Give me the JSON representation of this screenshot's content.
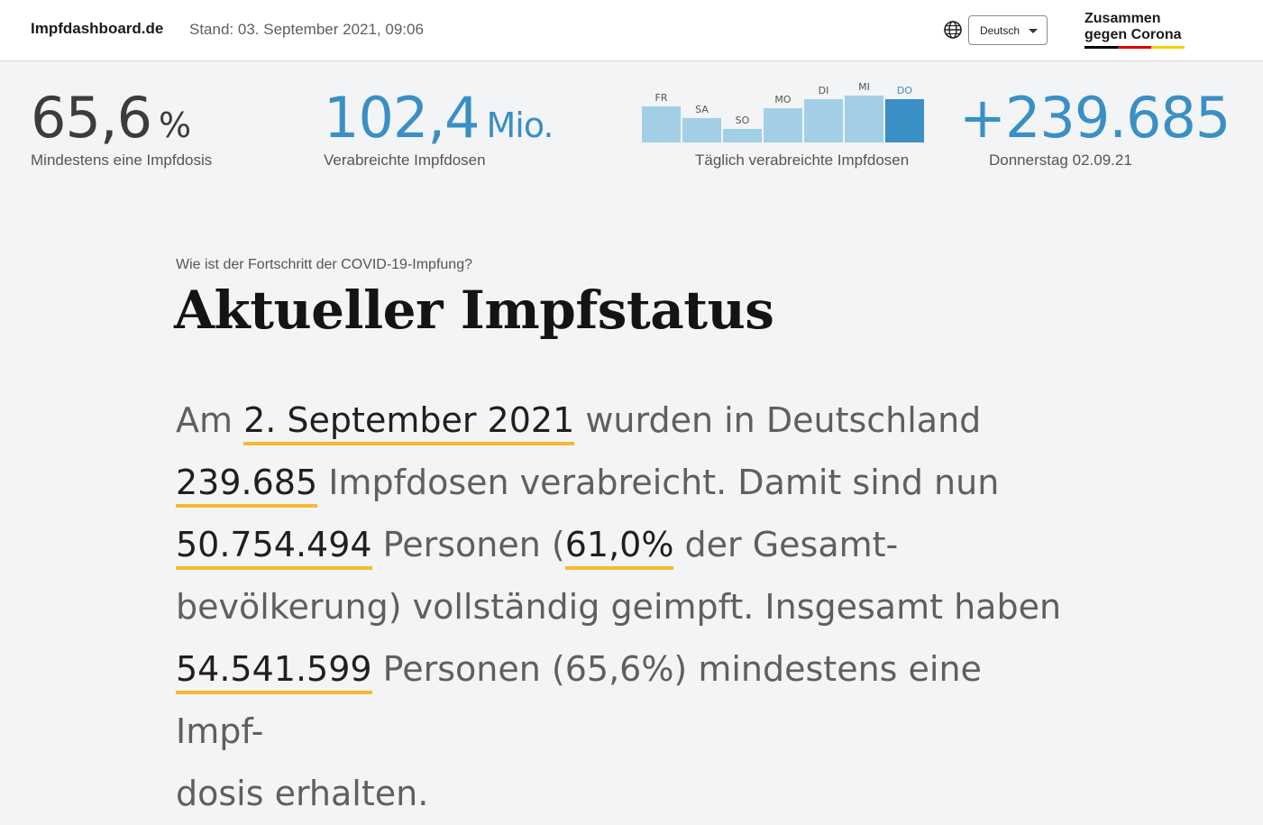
{
  "header": {
    "brand": "Impfdashboard.de",
    "stand": "Stand: 03. September 2021, 09:06",
    "globe_icon": "globe-icon",
    "language": "Deutsch",
    "logo_line1": "Zusammen",
    "logo_line2": "gegen Corona",
    "logo_colors": [
      "#000000",
      "#dd0000",
      "#ffcc00"
    ]
  },
  "stats": {
    "first_dose_value": "65,6",
    "first_dose_unit": "%",
    "first_dose_label": "Mindestens eine Impfdosis",
    "total_value": "102,4",
    "total_unit": "Mio.",
    "total_label": "Verabreichte Impfdosen",
    "daily_chart_label": "Täglich verabreichte Impfdosen",
    "daily_value": "+239.685",
    "daily_label": "Donnerstag 02.09.21"
  },
  "chart_data": {
    "type": "bar",
    "categories": [
      "FR",
      "SA",
      "SO",
      "MO",
      "DI",
      "MI",
      "DO"
    ],
    "values": [
      0.77,
      0.51,
      0.29,
      0.73,
      0.92,
      1.0,
      0.93
    ],
    "highlight_index": 6,
    "colors": {
      "bar": "#a3cfe6",
      "highlight": "#3a8fc4"
    }
  },
  "main": {
    "kicker": "Wie ist der Fortschritt der COVID-19-Impfung?",
    "title": "Aktueller Impfstatus",
    "p1": "Am ",
    "date": "2. September 2021",
    "p2": " wurden in Deutschland",
    "doses": "239.685",
    "p3": " Impfdosen verabreicht. Damit sind nun",
    "fully": "50.754.494",
    "p4": " Personen (",
    "fully_pct": "61,0%",
    "p5": " der Gesamt-",
    "p6": "bevölkerung) vollständig geimpft. Insgesamt haben",
    "once": "54.541.599",
    "p7": " Personen (65,6%) mindestens eine Impf-",
    "p8": "dosis erhalten."
  },
  "colors": {
    "accent_blue": "#3a8fc4",
    "highlight_underline": "#f5b935"
  }
}
